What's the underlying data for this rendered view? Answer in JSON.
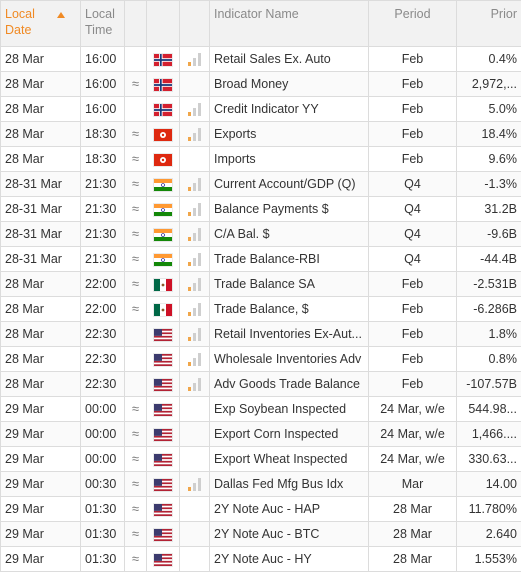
{
  "header": {
    "local_date": "Local Date",
    "local_time": "Local Time",
    "indicator": "Indicator Name",
    "period": "Period",
    "prior": "Prior"
  },
  "colors": {
    "accent": "#f08a24",
    "importance_on": "#f0a64a"
  },
  "rows": [
    {
      "date": "28 Mar",
      "time": "16:00",
      "approx": "",
      "flag": "norway",
      "imp": 1,
      "indicator": "Retail Sales Ex. Auto",
      "period": "Feb",
      "prior": "0.4%"
    },
    {
      "date": "28 Mar",
      "time": "16:00",
      "approx": "≈",
      "flag": "norway",
      "imp": 0,
      "indicator": "Broad Money",
      "period": "Feb",
      "prior": "2,972,..."
    },
    {
      "date": "28 Mar",
      "time": "16:00",
      "approx": "",
      "flag": "norway",
      "imp": 1,
      "indicator": "Credit Indicator YY",
      "period": "Feb",
      "prior": "5.0%"
    },
    {
      "date": "28 Mar",
      "time": "18:30",
      "approx": "≈",
      "flag": "hongkong",
      "imp": 1,
      "indicator": "Exports",
      "period": "Feb",
      "prior": "18.4%"
    },
    {
      "date": "28 Mar",
      "time": "18:30",
      "approx": "≈",
      "flag": "hongkong",
      "imp": 0,
      "indicator": "Imports",
      "period": "Feb",
      "prior": "9.6%"
    },
    {
      "date": "28-31 Mar",
      "time": "21:30",
      "approx": "≈",
      "flag": "india",
      "imp": 1,
      "indicator": "Current Account/GDP (Q)",
      "period": "Q4",
      "prior": "-1.3%"
    },
    {
      "date": "28-31 Mar",
      "time": "21:30",
      "approx": "≈",
      "flag": "india",
      "imp": 1,
      "indicator": "Balance Payments $",
      "period": "Q4",
      "prior": "31.2B"
    },
    {
      "date": "28-31 Mar",
      "time": "21:30",
      "approx": "≈",
      "flag": "india",
      "imp": 1,
      "indicator": "C/A Bal. $",
      "period": "Q4",
      "prior": "-9.6B"
    },
    {
      "date": "28-31 Mar",
      "time": "21:30",
      "approx": "≈",
      "flag": "india",
      "imp": 1,
      "indicator": "Trade Balance-RBI",
      "period": "Q4",
      "prior": "-44.4B"
    },
    {
      "date": "28 Mar",
      "time": "22:00",
      "approx": "≈",
      "flag": "mexico",
      "imp": 1,
      "indicator": "Trade Balance SA",
      "period": "Feb",
      "prior": "-2.531B"
    },
    {
      "date": "28 Mar",
      "time": "22:00",
      "approx": "≈",
      "flag": "mexico",
      "imp": 1,
      "indicator": "Trade Balance, $",
      "period": "Feb",
      "prior": "-6.286B"
    },
    {
      "date": "28 Mar",
      "time": "22:30",
      "approx": "",
      "flag": "usa",
      "imp": 1,
      "indicator": "Retail Inventories Ex-Aut...",
      "period": "Feb",
      "prior": "1.8%"
    },
    {
      "date": "28 Mar",
      "time": "22:30",
      "approx": "",
      "flag": "usa",
      "imp": 1,
      "indicator": "Wholesale Inventories Adv",
      "period": "Feb",
      "prior": "0.8%"
    },
    {
      "date": "28 Mar",
      "time": "22:30",
      "approx": "",
      "flag": "usa",
      "imp": 1,
      "indicator": "Adv Goods Trade Balance",
      "period": "Feb",
      "prior": "-107.57B"
    },
    {
      "date": "29 Mar",
      "time": "00:00",
      "approx": "≈",
      "flag": "usa",
      "imp": 0,
      "indicator": "Exp Soybean Inspected",
      "period": "24 Mar, w/e",
      "prior": "544.98..."
    },
    {
      "date": "29 Mar",
      "time": "00:00",
      "approx": "≈",
      "flag": "usa",
      "imp": 0,
      "indicator": "Export Corn Inspected",
      "period": "24 Mar, w/e",
      "prior": "1,466...."
    },
    {
      "date": "29 Mar",
      "time": "00:00",
      "approx": "≈",
      "flag": "usa",
      "imp": 0,
      "indicator": "Export Wheat Inspected",
      "period": "24 Mar, w/e",
      "prior": "330.63..."
    },
    {
      "date": "29 Mar",
      "time": "00:30",
      "approx": "≈",
      "flag": "usa",
      "imp": 1,
      "indicator": "Dallas Fed Mfg Bus Idx",
      "period": "Mar",
      "prior": "14.00"
    },
    {
      "date": "29 Mar",
      "time": "01:30",
      "approx": "≈",
      "flag": "usa",
      "imp": 0,
      "indicator": "2Y Note Auc - HAP",
      "period": "28 Mar",
      "prior": "11.780%"
    },
    {
      "date": "29 Mar",
      "time": "01:30",
      "approx": "≈",
      "flag": "usa",
      "imp": 0,
      "indicator": "2Y Note Auc - BTC",
      "period": "28 Mar",
      "prior": "2.640"
    },
    {
      "date": "29 Mar",
      "time": "01:30",
      "approx": "≈",
      "flag": "usa",
      "imp": 0,
      "indicator": "2Y Note Auc - HY",
      "period": "28 Mar",
      "prior": "1.553%"
    }
  ]
}
